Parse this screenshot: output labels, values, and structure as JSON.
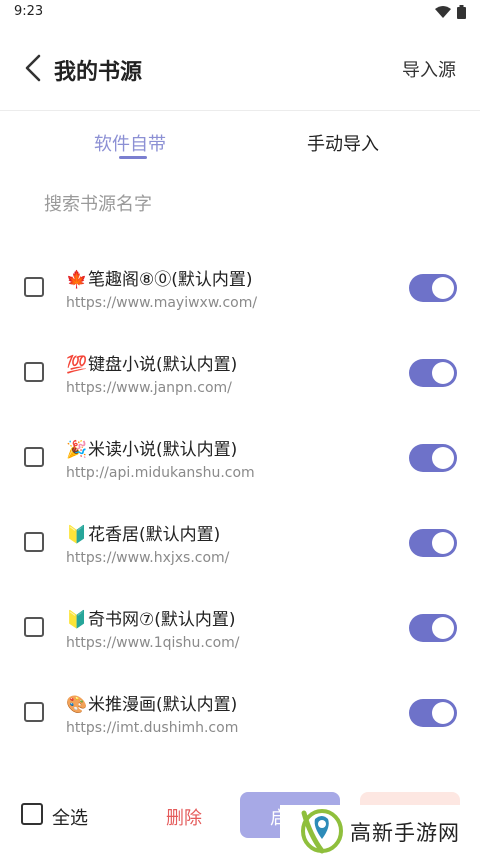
{
  "status_bar": {
    "time": "9:23",
    "wifi_icon": "wifi-icon",
    "battery_icon": "battery-icon"
  },
  "app_bar": {
    "title": "我的书源",
    "import_label": "导入源",
    "back_icon": "chevron-left-icon"
  },
  "tabs": [
    {
      "label": "软件自带",
      "active": true
    },
    {
      "label": "手动导入",
      "active": false
    }
  ],
  "search": {
    "placeholder": "搜索书源名字",
    "value": ""
  },
  "sources": [
    {
      "emoji": "🍁",
      "name": "笔趣阁⑧⓪(默认内置)",
      "url": "https://www.mayiwxw.com/",
      "enabled": true,
      "checked": false
    },
    {
      "emoji": "💯",
      "name": "键盘小说(默认内置)",
      "url": "https://www.janpn.com/",
      "enabled": true,
      "checked": false
    },
    {
      "emoji": "🎉",
      "name": "米读小说(默认内置)",
      "url": "http://api.midukanshu.com",
      "enabled": true,
      "checked": false
    },
    {
      "emoji": "🔰",
      "name": "花香居(默认内置)",
      "url": "https://www.hxjxs.com/",
      "enabled": true,
      "checked": false
    },
    {
      "emoji": "🔰",
      "name": "奇书网⑦(默认内置)",
      "url": "https://www.1qishu.com/",
      "enabled": true,
      "checked": false
    },
    {
      "emoji": "🎨",
      "name": "米推漫画(默认内置)",
      "url": "https://imt.dushimh.com",
      "enabled": true,
      "checked": false
    }
  ],
  "bottom_bar": {
    "select_all_label": "全选",
    "delete_label": "删除",
    "enable_label": "启"
  },
  "watermark": {
    "text": "高新手游网"
  },
  "colors": {
    "accent": "#6e72c9",
    "tab_active": "#8c90d4",
    "delete": "#e45b5b",
    "enable_btn": "#a7a9e6",
    "disable_btn": "#fde7e2"
  }
}
